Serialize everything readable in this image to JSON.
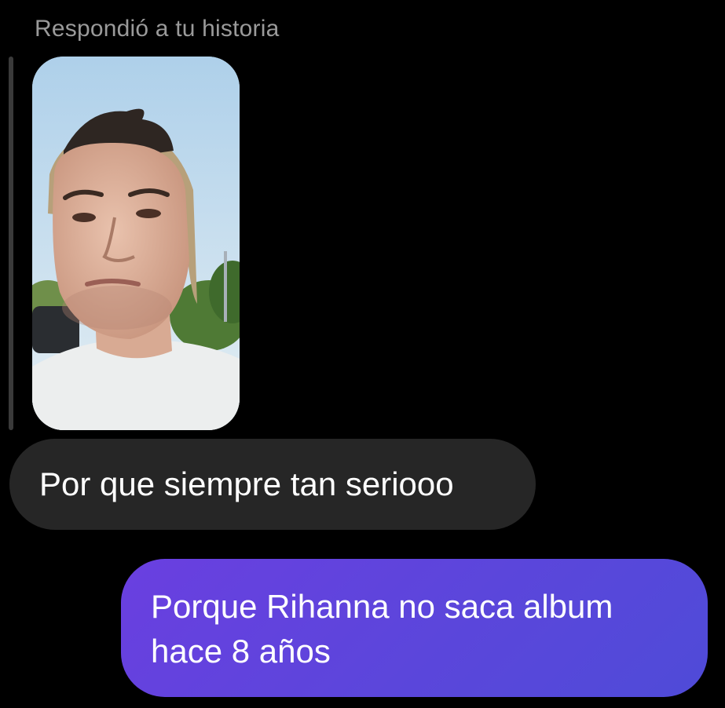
{
  "story_reply": {
    "label": "Respondió a tu historia",
    "thumbnail_subject": "selfie-photo"
  },
  "messages": [
    {
      "direction": "received",
      "text": "Por que siempre tan seriooo"
    },
    {
      "direction": "sent",
      "text": "Porque Rihanna no saca album\nhace 8 años"
    }
  ],
  "colors": {
    "background": "#000000",
    "received_bubble": "#262626",
    "sent_bubble_start": "#6a3fe0",
    "sent_bubble_end": "#4f4bd8",
    "label_text": "#9a9a9a",
    "message_text": "#ffffff"
  }
}
